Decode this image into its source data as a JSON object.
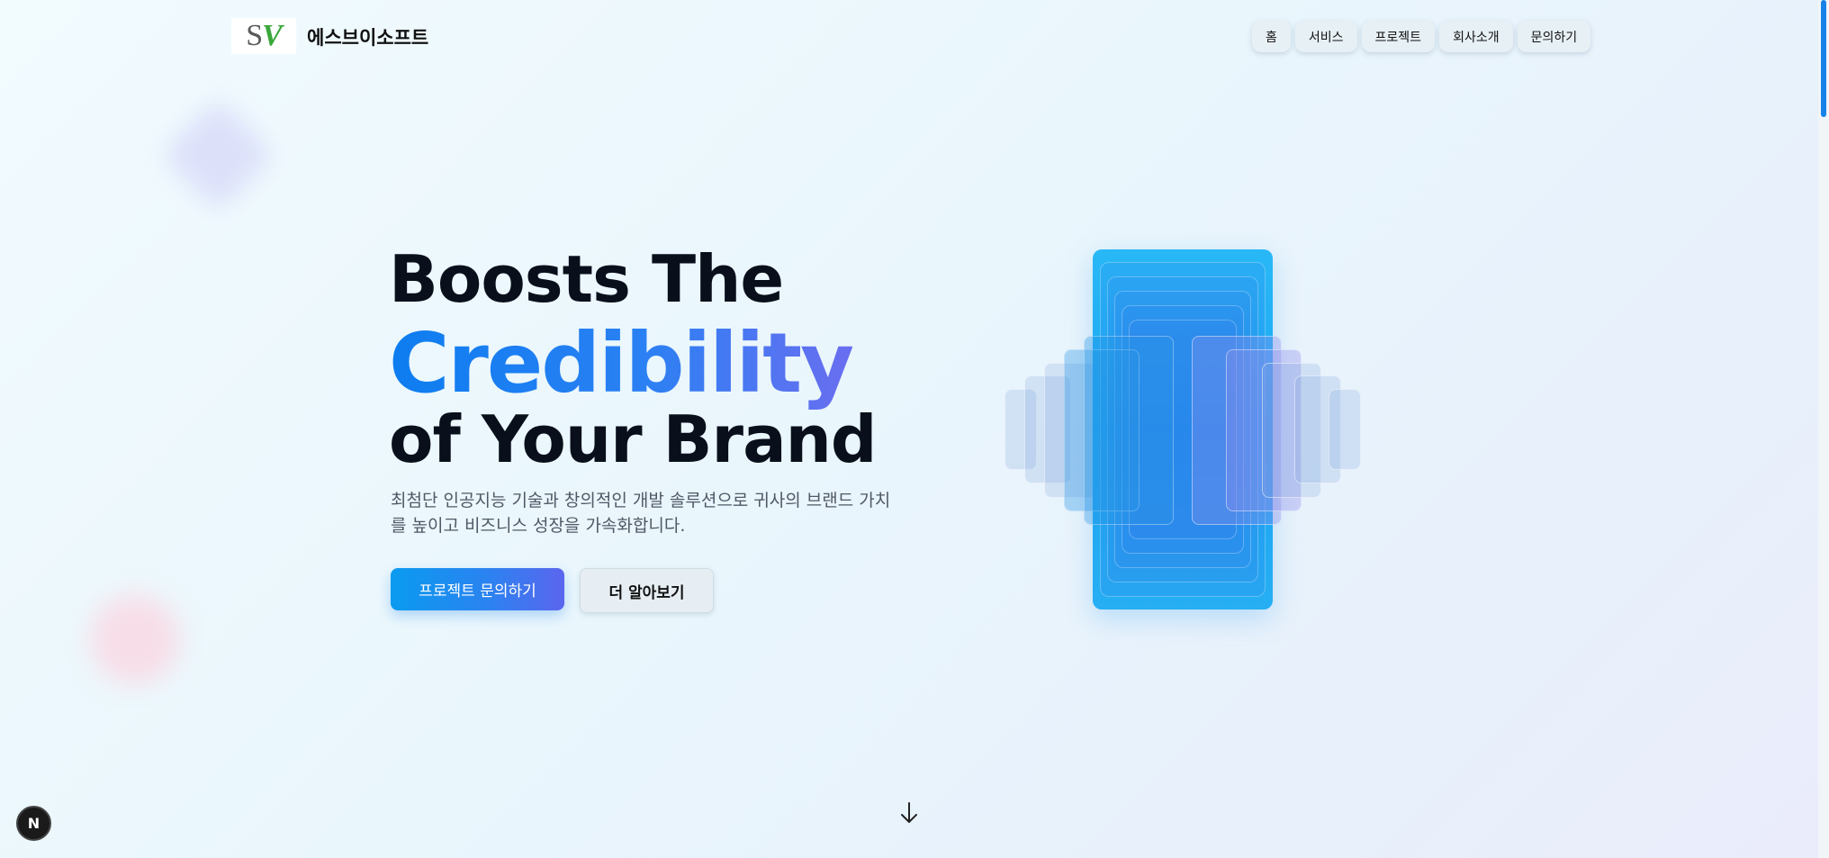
{
  "header": {
    "logo_text_s": "S",
    "logo_text_v": "V",
    "brand_name": "에스브이소프트",
    "nav": [
      "홈",
      "서비스",
      "프로젝트",
      "회사소개",
      "문의하기"
    ]
  },
  "hero": {
    "line1": "Boosts The",
    "line2": "Credibility",
    "line3": "of Your Brand",
    "description": "최첨단 인공지능 기술과 창의적인 개발 솔루션으로 귀사의 브랜드 가치를 높이고 비즈니스 성장을 가속화합니다.",
    "primary_button": "프로젝트 문의하기",
    "secondary_button": "더 알아보기"
  },
  "badge": {
    "label": "N"
  },
  "colors": {
    "accent": "#0d7df0",
    "gradient_end": "#6a6ef0",
    "phone": "#1aa6f3"
  },
  "icons": {
    "scroll": "arrow-down-icon"
  }
}
